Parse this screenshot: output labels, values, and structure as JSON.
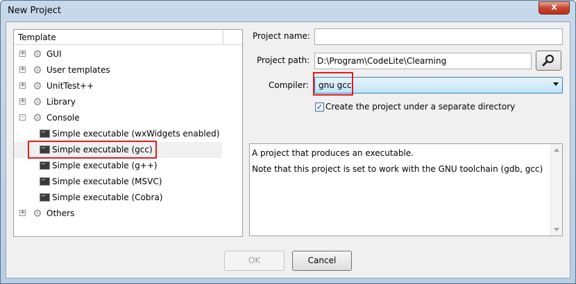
{
  "window": {
    "title": "New Project",
    "close_symbol": "x"
  },
  "tree": {
    "header": "Template",
    "items": [
      {
        "label": "GUI",
        "expander": "+",
        "icon": "gear-icon"
      },
      {
        "label": "User templates",
        "expander": "+",
        "icon": "gear-icon"
      },
      {
        "label": "UnitTest++",
        "expander": "+",
        "icon": "gear-icon"
      },
      {
        "label": "Library",
        "expander": "+",
        "icon": "gear-icon"
      },
      {
        "label": "Console",
        "expander": "-",
        "icon": "gear-icon"
      },
      {
        "label": "Simple executable (wxWidgets enabled)",
        "icon": "console-icon"
      },
      {
        "label": "Simple executable (gcc)",
        "icon": "console-icon",
        "selected": true
      },
      {
        "label": "Simple executable (g++)",
        "icon": "console-icon"
      },
      {
        "label": "Simple executable (MSVC)",
        "icon": "console-icon"
      },
      {
        "label": "Simple executable (Cobra)",
        "icon": "console-icon"
      },
      {
        "label": "Others",
        "expander": "+",
        "icon": "gear-icon"
      }
    ]
  },
  "form": {
    "project_name_label": "Project name:",
    "project_name_value": "",
    "project_path_label": "Project path:",
    "project_path_value": "D:\\Program\\CodeLite\\Clearning",
    "compiler_label": "Compiler:",
    "compiler_value": "gnu gcc",
    "separate_dir_label": "Create the project under a separate directory",
    "separate_dir_checked": true
  },
  "description": {
    "line1": "A project that produces an executable.",
    "line2": "Note that this project is set to work with the GNU toolchain (gdb, gcc)"
  },
  "buttons": {
    "ok": "OK",
    "cancel": "Cancel"
  },
  "colors": {
    "highlight_box": "#e11b1b",
    "combo_accent": "#3c7fb1"
  }
}
